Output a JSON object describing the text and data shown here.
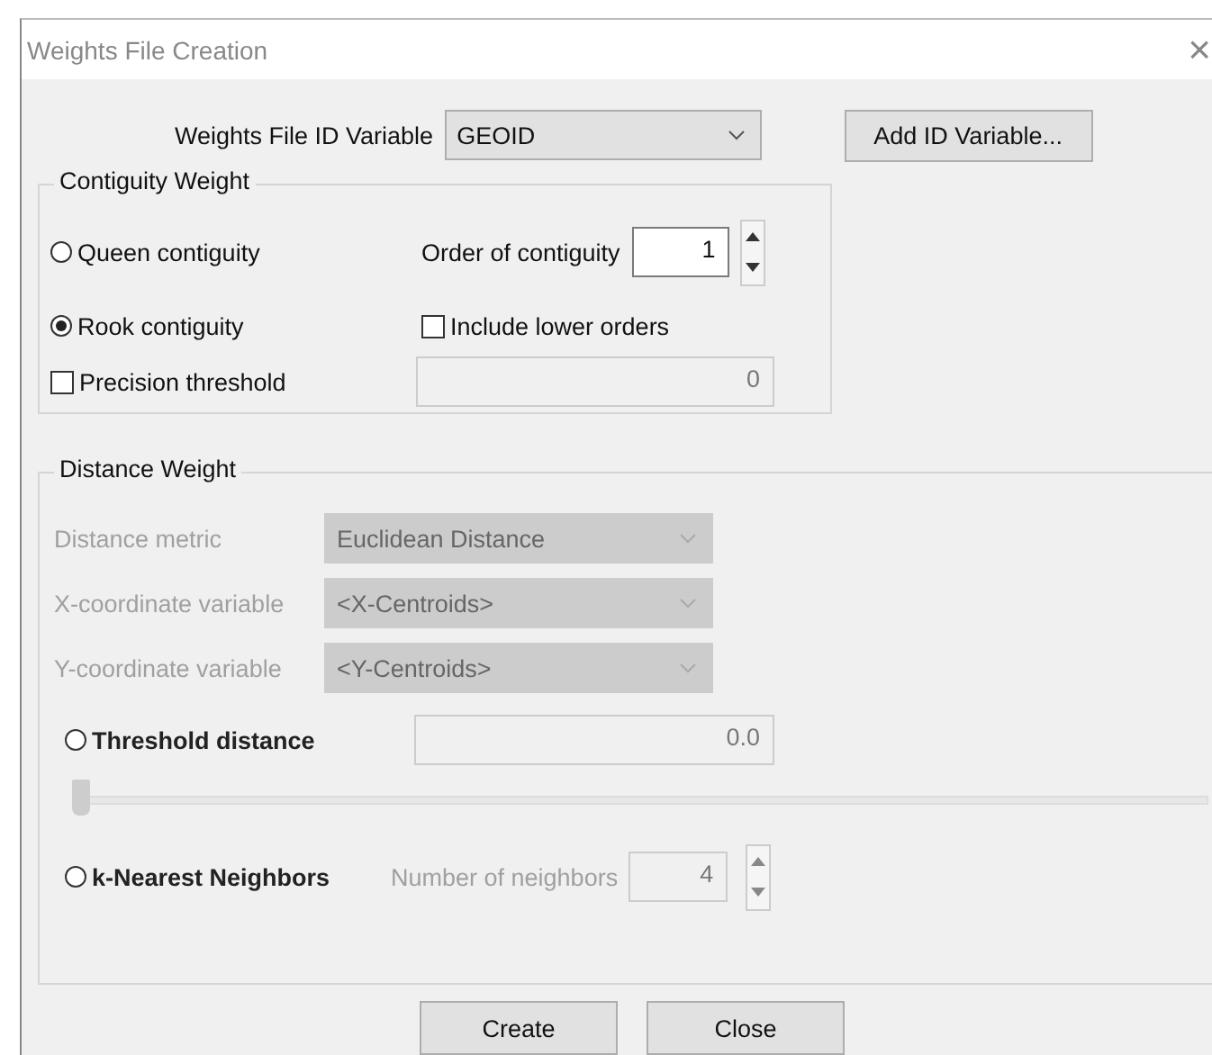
{
  "window": {
    "title": "Weights File Creation",
    "close": "×"
  },
  "id_variable": {
    "label": "Weights File ID Variable",
    "value": "GEOID",
    "button": "Add ID Variable..."
  },
  "contiguity": {
    "title": "Contiguity Weight",
    "queen": {
      "label": "Queen contiguity",
      "selected": false
    },
    "order": {
      "label": "Order of contiguity",
      "value": "1"
    },
    "rook": {
      "label": "Rook contiguity",
      "selected": true
    },
    "include_lower": {
      "label": "Include lower orders",
      "checked": false
    },
    "precision": {
      "label": "Precision threshold",
      "checked": false,
      "value": "0",
      "disabled": true
    }
  },
  "distance": {
    "title": "Distance Weight",
    "rows": [
      {
        "label": "Distance metric",
        "value": "Euclidean Distance",
        "disabled": true
      },
      {
        "label": "X-coordinate variable",
        "value": "<X-Centroids>",
        "disabled": true
      },
      {
        "label": "Y-coordinate variable",
        "value": "<Y-Centroids>",
        "disabled": true
      }
    ],
    "threshold": {
      "label": "Threshold distance",
      "selected": false,
      "value": "0.0",
      "level": 0
    },
    "knn": {
      "label": "k-Nearest Neighbors",
      "selected": false,
      "neighbors_label": "Number of neighbors",
      "value": "4",
      "disabled": true
    }
  },
  "buttons": [
    "Create",
    "Close"
  ]
}
